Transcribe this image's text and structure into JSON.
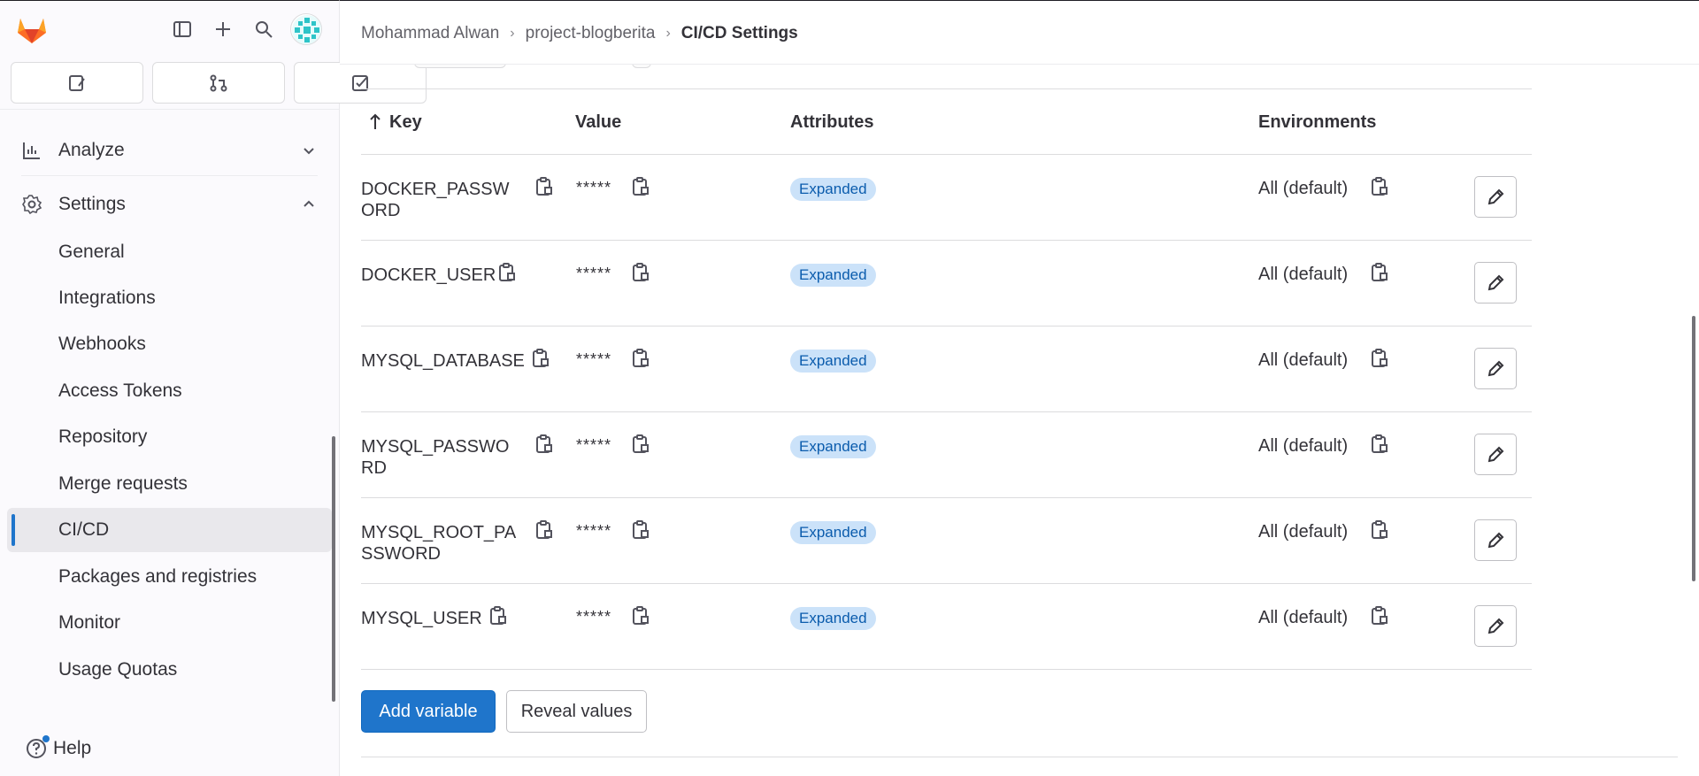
{
  "sidebar": {
    "quick_actions": [
      "issues",
      "merge-requests",
      "todos"
    ],
    "nav": [
      {
        "label": "Analyze",
        "icon": "chart-icon",
        "expanded": false
      },
      {
        "label": "Settings",
        "icon": "gear-icon",
        "expanded": true
      }
    ],
    "settings_items": [
      {
        "label": "General"
      },
      {
        "label": "Integrations"
      },
      {
        "label": "Webhooks"
      },
      {
        "label": "Access Tokens"
      },
      {
        "label": "Repository"
      },
      {
        "label": "Merge requests"
      },
      {
        "label": "CI/CD",
        "active": true
      },
      {
        "label": "Packages and registries"
      },
      {
        "label": "Monitor"
      },
      {
        "label": "Usage Quotas"
      }
    ],
    "help_label": "Help"
  },
  "breadcrumb": {
    "items": [
      "Mohammad Alwan",
      "project-blogberita",
      "CI/CD Settings"
    ]
  },
  "table": {
    "headers": {
      "key": "Key",
      "value": "Value",
      "attributes": "Attributes",
      "environments": "Environments"
    },
    "rows": [
      {
        "key": "DOCKER_PASSWORD",
        "value": "*****",
        "badge": "Expanded",
        "env": "All (default)"
      },
      {
        "key": "DOCKER_USER",
        "value": "*****",
        "badge": "Expanded",
        "env": "All (default)"
      },
      {
        "key": "MYSQL_DATABASE",
        "value": "*****",
        "badge": "Expanded",
        "env": "All (default)"
      },
      {
        "key": "MYSQL_PASSWORD",
        "value": "*****",
        "badge": "Expanded",
        "env": "All (default)"
      },
      {
        "key": "MYSQL_ROOT_PASSWORD",
        "value": "*****",
        "badge": "Expanded",
        "env": "All (default)"
      },
      {
        "key": "MYSQL_USER",
        "value": "*****",
        "badge": "Expanded",
        "env": "All (default)"
      }
    ]
  },
  "actions": {
    "add_label": "Add variable",
    "reveal_label": "Reveal values"
  },
  "colors": {
    "accent": "#1f75cb",
    "badge_bg": "#cbe2f9",
    "badge_text": "#0b5cad",
    "logo": "#e24329"
  }
}
